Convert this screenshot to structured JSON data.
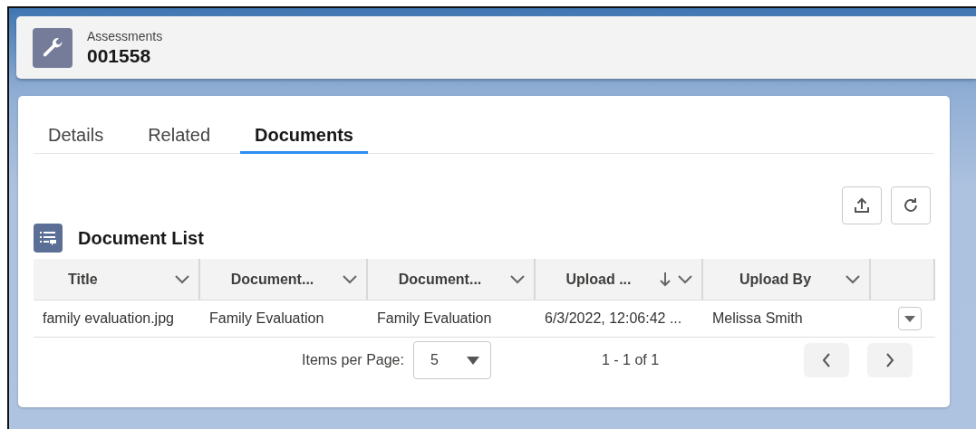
{
  "record": {
    "object": "Assessments",
    "name": "001558"
  },
  "tabs": [
    {
      "label": "Details",
      "selected": false
    },
    {
      "label": "Related",
      "selected": false
    },
    {
      "label": "Documents",
      "selected": true
    }
  ],
  "document_list": {
    "title": "Document List",
    "columns": [
      {
        "label": "Title",
        "sorted": false
      },
      {
        "label": "Document...",
        "sorted": false
      },
      {
        "label": "Document...",
        "sorted": false
      },
      {
        "label": "Upload ...",
        "sorted": true
      },
      {
        "label": "Upload By",
        "sorted": false
      }
    ],
    "rows": [
      {
        "cells": [
          "family evaluation.jpg",
          "Family Evaluation",
          "Family Evaluation",
          "6/3/2022, 12:06:42 ...",
          "Melissa Smith"
        ]
      }
    ],
    "pagination": {
      "label": "Items per Page:",
      "value": "5",
      "range": "1 - 1 of 1"
    }
  }
}
